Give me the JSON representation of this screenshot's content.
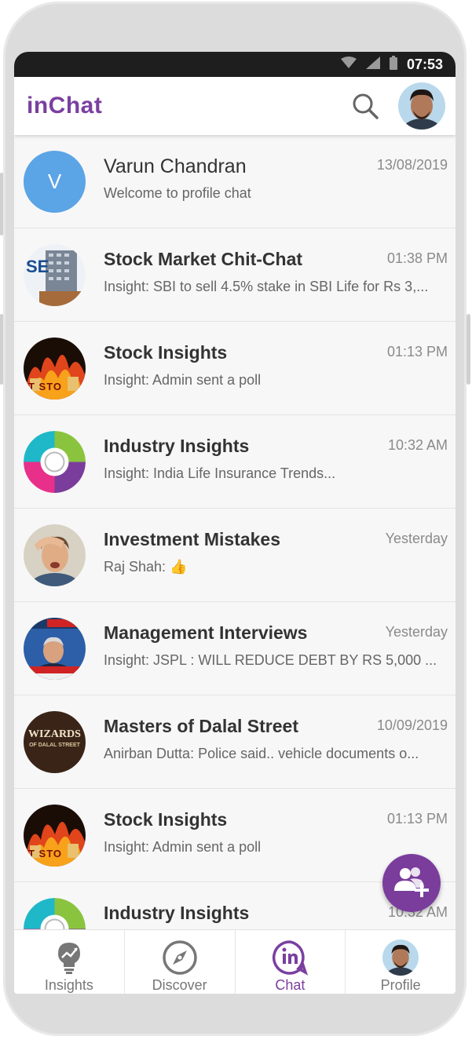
{
  "status_bar": {
    "time": "07:53"
  },
  "app_bar": {
    "title": "inChat"
  },
  "chats": [
    {
      "name": "Varun Chandran",
      "message": "Welcome to profile chat",
      "time": "13/08/2019",
      "avatar_letter": "V",
      "avatar_color": "#5ba4e6"
    },
    {
      "name": "Stock Market Chit-Chat",
      "message": "Insight: SBI to sell 4.5% stake in SBI Life for Rs 3,...",
      "time": "01:38 PM",
      "avatar_text": "SE"
    },
    {
      "name": "Stock Insights",
      "message": "Insight: Admin sent a poll",
      "time": "01:13 PM",
      "avatar_text": "T STO"
    },
    {
      "name": "Industry Insights",
      "message": "Insight: India Life Insurance Trends...",
      "time": "10:32 AM"
    },
    {
      "name": "Investment Mistakes",
      "message": "Raj Shah: 👍",
      "time": "Yesterday"
    },
    {
      "name": "Management Interviews",
      "message": "Insight: JSPL : WILL REDUCE DEBT BY RS 5,000 ...",
      "time": "Yesterday"
    },
    {
      "name": "Masters of Dalal Street",
      "message": "Anirban Dutta: Police said.. vehicle documents o...",
      "time": "10/09/2019",
      "avatar_text": "WIZARDS",
      "avatar_subtext": "OF DALAL STREET"
    },
    {
      "name": "Stock Insights",
      "message": "Insight: Admin sent a poll",
      "time": "01:13 PM",
      "avatar_text": "T STO"
    },
    {
      "name": "Industry Insights",
      "message": "",
      "time": "10:32 AM"
    }
  ],
  "nav": {
    "tabs": [
      {
        "label": "Insights",
        "icon": "bulb-chart-icon"
      },
      {
        "label": "Discover",
        "icon": "compass-icon"
      },
      {
        "label": "Chat",
        "icon": "inchat-logo-icon"
      },
      {
        "label": "Profile",
        "icon": "avatar"
      }
    ],
    "active": "Chat"
  },
  "colors": {
    "brand": "#7b3fa0",
    "fab": "#7a3d9c"
  }
}
